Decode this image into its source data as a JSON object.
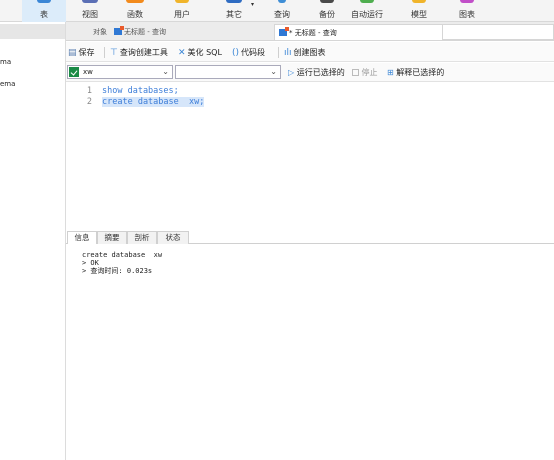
{
  "toolbar": {
    "items": [
      {
        "label": "表",
        "color": "#3a86d6"
      },
      {
        "label": "视图",
        "color": "#5b6fb5"
      },
      {
        "label": "函数",
        "color": "#f28a1c"
      },
      {
        "label": "用户",
        "color": "#f0b42a"
      },
      {
        "label": "其它",
        "color": "#2f6cc2"
      },
      {
        "label": "查询",
        "color": "#3f8ed6"
      },
      {
        "label": "备份",
        "color": "#4a4a4a"
      },
      {
        "label": "自动运行",
        "color": "#4fae4f"
      },
      {
        "label": "模型",
        "color": "#f0b42a"
      },
      {
        "label": "图表",
        "color": "#c14fc8"
      }
    ]
  },
  "sidebar": {
    "items": [
      "ma",
      "ema"
    ]
  },
  "tabs": {
    "objects": "对象",
    "untitled_query": "无标题 - 查询",
    "active_query": "* 无标题 - 查询"
  },
  "editor_toolbar": {
    "save": "保存",
    "query_builder": "查询创建工具",
    "beautify_sql": "美化 SQL",
    "code_snippet": "代码段",
    "create_chart": "创建图表"
  },
  "selectors": {
    "connection": "xw",
    "database": ""
  },
  "run_controls": {
    "run_selected": "运行已选择的",
    "stop": "停止",
    "explain_selected": "解释已选择的"
  },
  "editor": {
    "lines": [
      {
        "number": "1",
        "text": "show databases;"
      },
      {
        "number": "2",
        "text": "create database  xw;"
      }
    ]
  },
  "result_tabs": [
    "信息",
    "摘要",
    "剖析",
    "状态"
  ],
  "output": {
    "lines": [
      "create database  xw",
      "> OK",
      "> 查询时间: 0.023s"
    ]
  }
}
